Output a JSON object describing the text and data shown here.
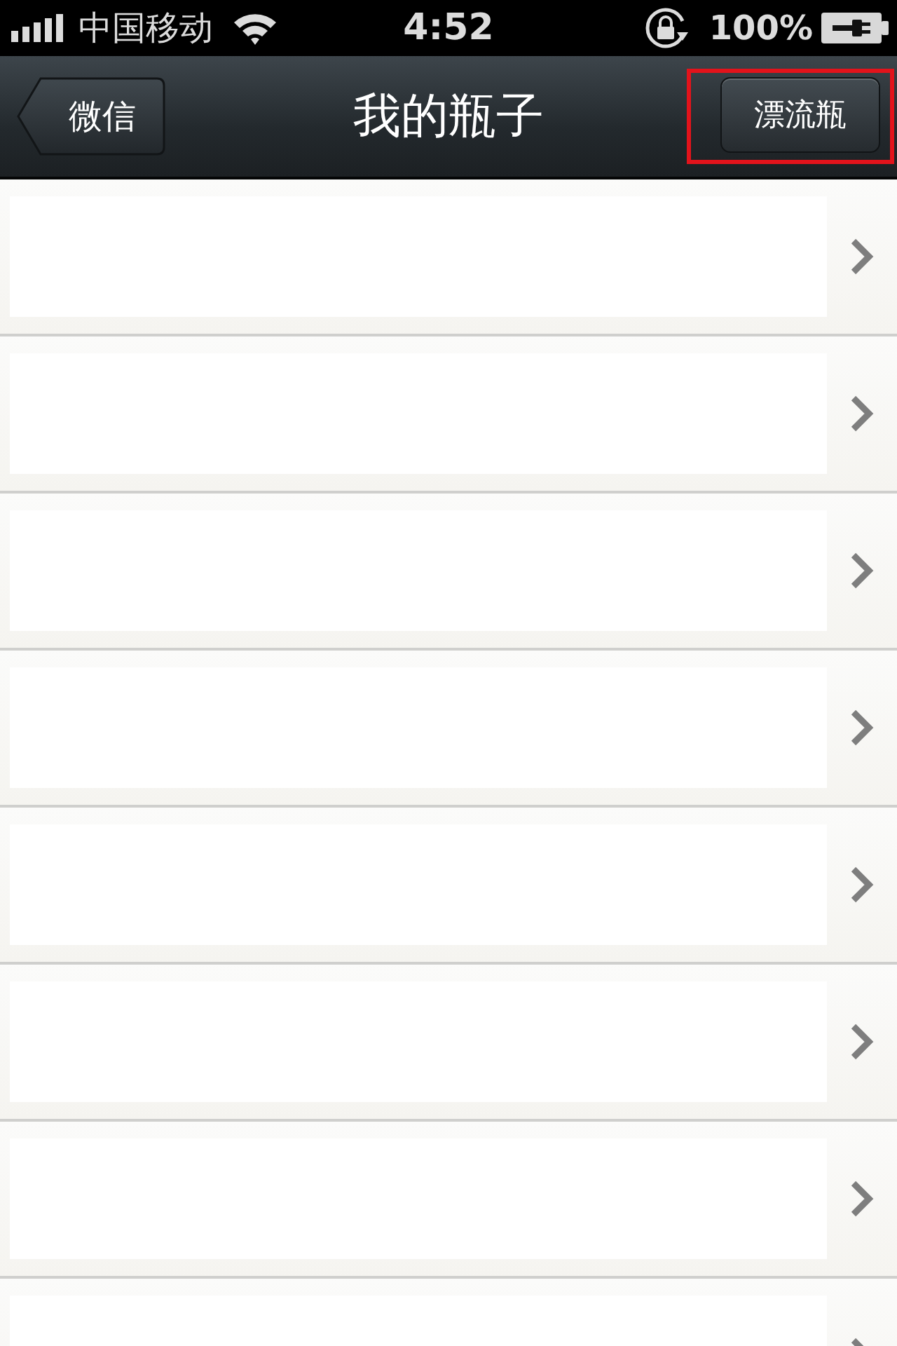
{
  "status_bar": {
    "carrier": "中国移动",
    "time": "4:52",
    "battery": "100%"
  },
  "nav": {
    "back_button": "微信",
    "title": "我的瓶子",
    "right_button": {
      "label": "漂流瓶",
      "highlighted": true
    }
  },
  "rows": [
    {
      "kind": "blank"
    },
    {
      "kind": "blank"
    },
    {
      "kind": "blank"
    },
    {
      "kind": "blank"
    },
    {
      "kind": "blank"
    },
    {
      "kind": "blank"
    },
    {
      "kind": "blank"
    },
    {
      "kind": "blank"
    }
  ]
}
